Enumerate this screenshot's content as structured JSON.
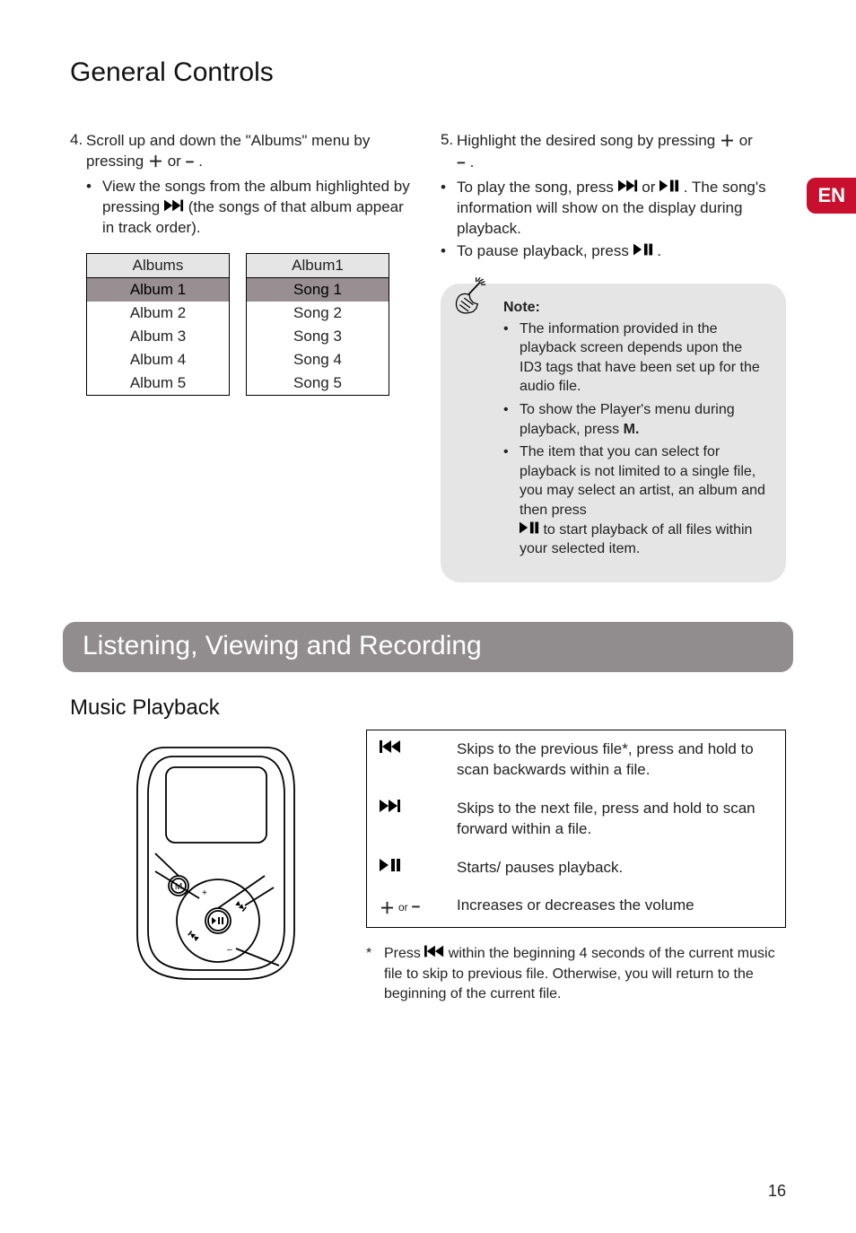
{
  "sideTab": "EN",
  "heading1": "General Controls",
  "left": {
    "step4_line": "Scroll up and down the \"Albums\" menu by pressing ",
    "step4_plus_or_minus_mid": " or ",
    "step4_after": " .",
    "bullet_view_a": "View the songs from the album highlighted by pressing ",
    "bullet_view_b": " (the songs of that album appear in track order).",
    "table1_header": "Albums",
    "table1_rows": [
      "Album 1",
      "Album 2",
      "Album 3",
      "Album 4",
      "Album 5"
    ],
    "table2_header": "Album1",
    "table2_rows": [
      "Song 1",
      "Song 2",
      "Song 3",
      "Song 4",
      "Song 5"
    ]
  },
  "right": {
    "step5_a": "Highlight the desired song by pressing ",
    "step5_mid": " or ",
    "step5_end": " .",
    "bullet_play_a": "To play the song, press ",
    "bullet_play_mid": " or ",
    "bullet_play_b": " . The song's information will show on the display during playback.",
    "bullet_pause_a": "To pause playback, press ",
    "bullet_pause_b": " ."
  },
  "note": {
    "title": "Note:",
    "items": [
      "The information provided in the playback screen depends upon the ID3 tags that have been set up for the audio file.",
      "To show the Player's menu during playback, press ",
      "The item that you can select for playback is not limited to a single file, you may select an artist, an album and then press ",
      " to start playback of all files within your selected item."
    ],
    "m_label": "M."
  },
  "band": "Listening, Viewing and Recording",
  "sub": "Music Playback",
  "controls": {
    "prev": "Skips to the previous file*, press and hold to scan backwards within a file.",
    "next": "Skips to the next file, press and hold to scan forward within a file.",
    "play": "Starts/ pauses playback.",
    "vol_or": "or",
    "vol": "Increases or decreases the volume"
  },
  "footnote_a": "Press ",
  "footnote_b": " within the beginning 4 seconds of the current music file to skip to previous file. Otherwise, you will return to the beginning of the current file.",
  "pagenum": "16"
}
